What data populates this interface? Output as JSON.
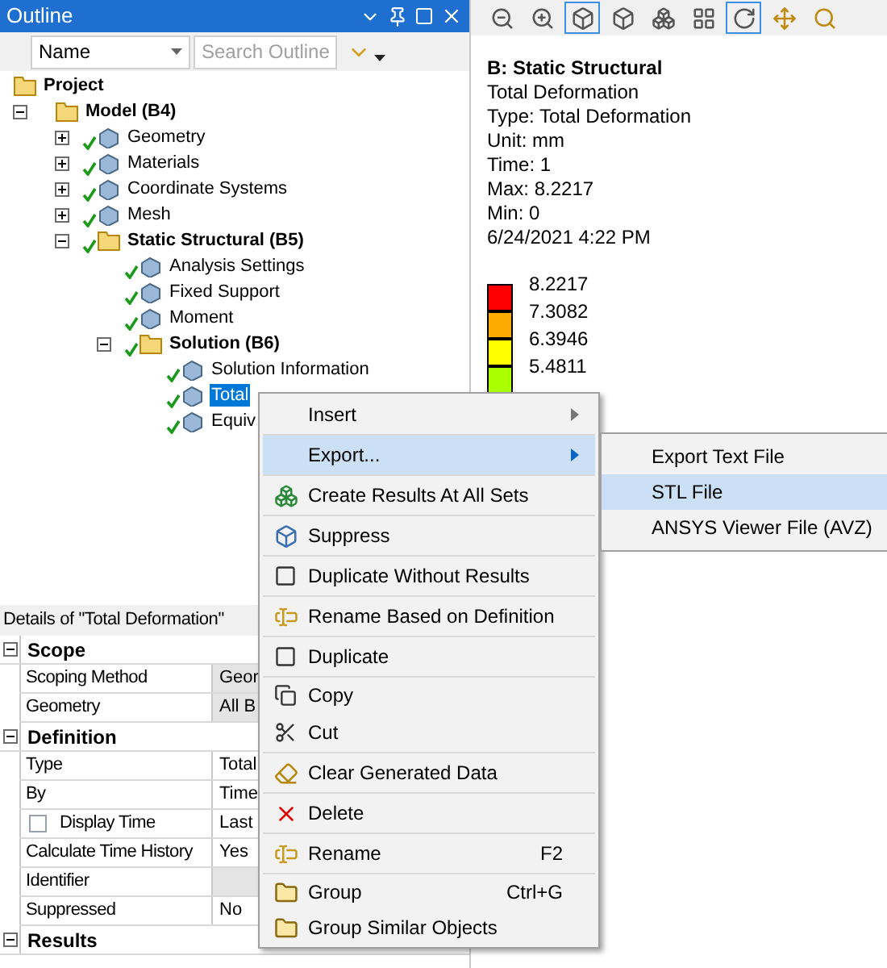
{
  "outline": {
    "title": "Outline",
    "name_filter": "Name",
    "search": {
      "placeholder": "Search Outline"
    },
    "tree": [
      {
        "label": "Project",
        "bold": true,
        "selected": false,
        "children": [
          {
            "label": "Model (B4)",
            "bold": true,
            "check": false,
            "selected": false,
            "expanded": true,
            "children": [
              {
                "label": "Geometry",
                "bold": false,
                "check": true,
                "selected": false,
                "expanded": false
              },
              {
                "label": "Materials",
                "bold": false,
                "check": true,
                "selected": false,
                "expanded": false
              },
              {
                "label": "Coordinate Systems",
                "bold": false,
                "check": true,
                "selected": false,
                "expanded": false
              },
              {
                "label": "Mesh",
                "bold": false,
                "check": true,
                "selected": false,
                "expanded": false
              },
              {
                "label": "Static Structural (B5)",
                "bold": true,
                "check": true,
                "selected": false,
                "expanded": true,
                "children": [
                  {
                    "label": "Analysis Settings",
                    "bold": false,
                    "check": true,
                    "selected": false
                  },
                  {
                    "label": "Fixed Support",
                    "bold": false,
                    "check": true,
                    "selected": false
                  },
                  {
                    "label": "Moment",
                    "bold": false,
                    "check": true,
                    "selected": false
                  },
                  {
                    "label": "Solution (B6)",
                    "bold": true,
                    "check": true,
                    "selected": false,
                    "expanded": true,
                    "children": [
                      {
                        "label": "Solution Information",
                        "bold": false,
                        "check": true,
                        "selected": false
                      },
                      {
                        "label": "Total",
                        "bold": false,
                        "check": true,
                        "selected": true
                      },
                      {
                        "label": "Equiv",
                        "bold": false,
                        "check": true,
                        "selected": false
                      }
                    ]
                  }
                ]
              }
            ]
          }
        ]
      }
    ]
  },
  "details": {
    "title": "Details of \"Total Deformation\"",
    "groups": [
      {
        "label": "Scope",
        "expanded": true,
        "rows": [
          {
            "label": "Scoping Method",
            "value": "Geor",
            "greyed": true
          },
          {
            "label": "Geometry",
            "value": "All B",
            "greyed": true
          }
        ]
      },
      {
        "label": "Definition",
        "expanded": true,
        "rows": [
          {
            "label": "Type",
            "value": "Total",
            "greyed": false
          },
          {
            "label": "By",
            "value": "Time",
            "greyed": false
          },
          {
            "label": "Display Time",
            "value": "Last",
            "greyed": false,
            "checkbox": {
              "checked": false
            }
          },
          {
            "label": "Calculate Time History",
            "value": "Yes",
            "greyed": false
          },
          {
            "label": "Identifier",
            "greyed": true
          },
          {
            "label": "Suppressed",
            "value": "No",
            "greyed": false
          }
        ]
      },
      {
        "label": "Results",
        "expanded": true
      }
    ]
  },
  "viewport": {
    "toolbar": [
      {
        "selected": false
      },
      {
        "selected": false
      },
      {
        "selected": true
      },
      {
        "selected": false
      },
      {
        "selected": false
      },
      {
        "selected": false
      },
      {
        "selected": true
      },
      {
        "selected": false
      },
      {
        "selected": false
      }
    ],
    "info": {
      "title": "B: Static Structural",
      "lines": [
        "Total Deformation",
        "Type: Total Deformation",
        "Unit: mm",
        "Time: 1",
        "Max: 8.2217",
        "Min: 0",
        "6/24/2021 4:22 PM"
      ]
    },
    "legend": {
      "bands": [
        {
          "color": "#ff0000"
        },
        {
          "color": "#ffaa00"
        },
        {
          "color": "#ffff00"
        },
        {
          "color": "#aaff00"
        }
      ],
      "labels": [
        "8.2217",
        "7.3082",
        "6.3946",
        "5.4811"
      ]
    }
  },
  "context_menu": {
    "items": [
      {
        "label": "Insert",
        "submenu": true,
        "selected": false,
        "separator_after": true
      },
      {
        "label": "Export...",
        "submenu": true,
        "selected": true,
        "separator_after": true
      },
      {
        "label": "Create Results At All Sets",
        "submenu": false,
        "selected": false,
        "separator_after": true
      },
      {
        "label": "Suppress",
        "submenu": false,
        "selected": false,
        "separator_after": true
      },
      {
        "label": "Duplicate Without Results",
        "submenu": false,
        "selected": false,
        "separator_after": true
      },
      {
        "label": "Rename Based on Definition",
        "submenu": false,
        "selected": false,
        "separator_after": true
      },
      {
        "label": "Duplicate",
        "submenu": false,
        "selected": false,
        "separator_after": true
      },
      {
        "label": "Copy",
        "submenu": false,
        "selected": false,
        "separator_after": false
      },
      {
        "label": "Cut",
        "submenu": false,
        "selected": false,
        "separator_after": true
      },
      {
        "label": "Clear Generated Data",
        "submenu": false,
        "selected": false,
        "separator_after": true
      },
      {
        "label": "Delete",
        "submenu": false,
        "selected": false,
        "separator_after": true
      },
      {
        "label": "Rename",
        "shortcut": "F2",
        "submenu": false,
        "selected": false,
        "separator_after": true
      },
      {
        "label": "Group",
        "shortcut": "Ctrl+G",
        "submenu": false,
        "selected": false,
        "separator_after": false
      },
      {
        "label": "Group Similar Objects",
        "submenu": false,
        "selected": false,
        "separator_after": false
      }
    ],
    "submenu": [
      {
        "label": "Export Text File",
        "selected": false
      },
      {
        "label": "STL File",
        "selected": true
      },
      {
        "label": "ANSYS Viewer File (AVZ)",
        "selected": false
      }
    ]
  }
}
